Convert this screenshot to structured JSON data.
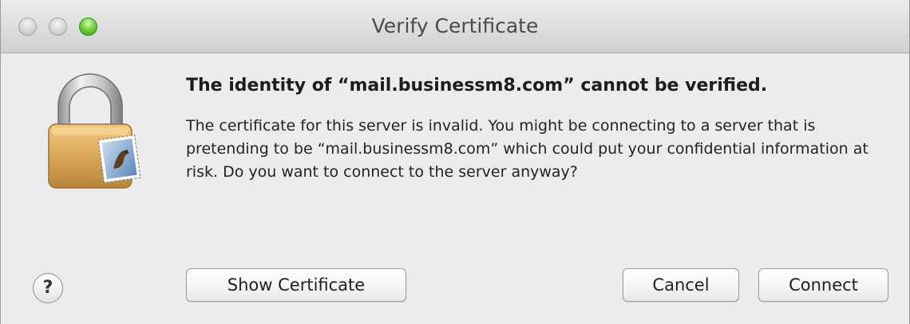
{
  "window": {
    "title": "Verify Certificate"
  },
  "icons": {
    "lock": "lock-with-mail-stamp-icon",
    "help": "help-icon"
  },
  "dialog": {
    "heading": "The identity of “mail.businessm8.com” cannot be verified.",
    "message": "The certificate for this server is invalid. You might be connecting to a server that is pretending to be “mail.businessm8.com” which could put your confidential information at risk. Do you want to connect to the server anyway?"
  },
  "buttons": {
    "help_label": "?",
    "show_certificate": "Show Certificate",
    "cancel": "Cancel",
    "connect": "Connect"
  },
  "colors": {
    "zoom_green": "#72d241",
    "lock_gold": "#d9a85a",
    "window_bg": "#ececec"
  }
}
